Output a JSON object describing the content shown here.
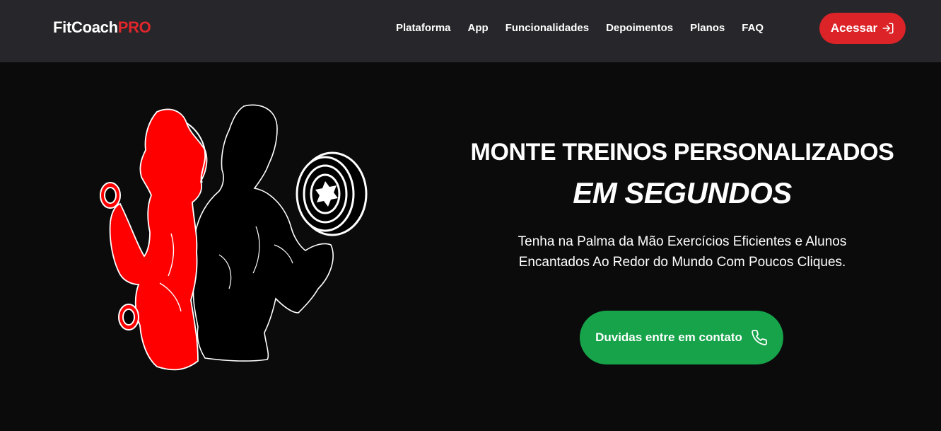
{
  "brand": {
    "name_main": "FitCoach",
    "name_accent": "PRO"
  },
  "nav": {
    "links": [
      "Plataforma",
      "App",
      "Funcionalidades",
      "Depoimentos",
      "Planos",
      "FAQ"
    ]
  },
  "header": {
    "login_label": "Acessar",
    "login_icon": "login-arrow-icon"
  },
  "hero": {
    "headline": "MONTE TREINOS PERSONALIZADOS",
    "headline_em": "EM SEGUNDOS",
    "subtitle": "Tenha na Palma da Mão Exercícios Eficientes e Alunos Encantados Ao Redor do Mundo Com Poucos Cliques.",
    "cta_label": "Duvidas entre em contato",
    "cta_icon": "phone-icon",
    "illustration": "fitness-couple-silhouette"
  },
  "colors": {
    "navbar_bg": "#26262b",
    "page_bg": "#0b0b0c",
    "accent_red": "#dc2328",
    "cta_green": "#16a34a"
  }
}
